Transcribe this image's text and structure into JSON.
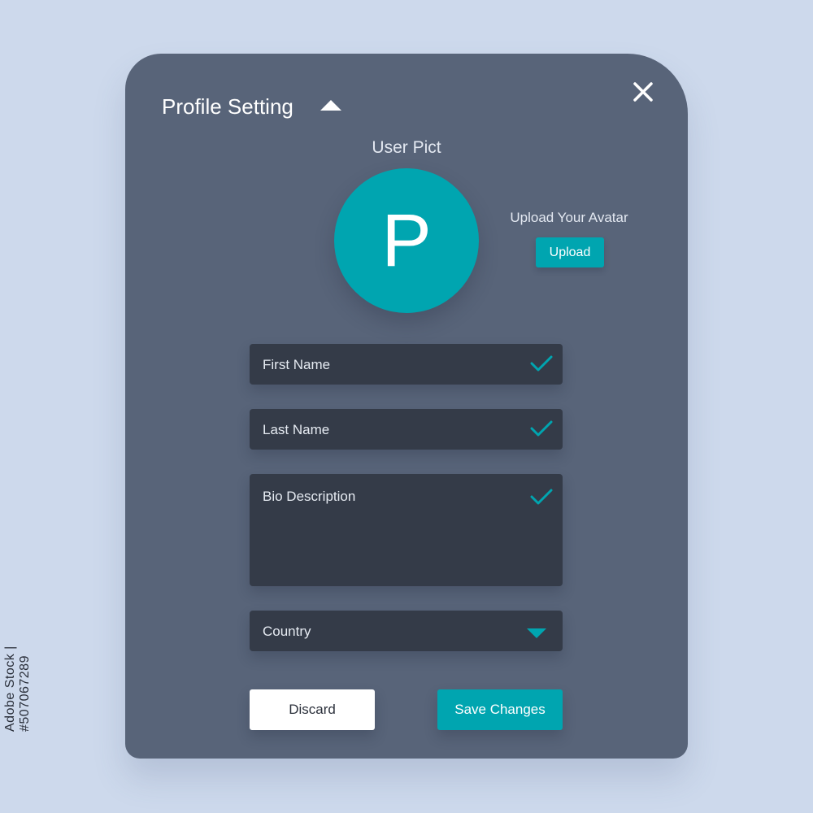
{
  "dialog": {
    "title": "Profile Setting",
    "icons": {
      "collapse": "triangle-up-icon",
      "close": "close-icon"
    }
  },
  "avatar": {
    "section_label": "User Pict",
    "initial": "P",
    "upload_label": "Upload Your Avatar",
    "upload_button": "Upload"
  },
  "form": {
    "first_name": {
      "label": "First Name",
      "status": "valid"
    },
    "last_name": {
      "label": "Last Name",
      "status": "valid"
    },
    "bio": {
      "label": "Bio Description",
      "status": "valid"
    },
    "country": {
      "label": "Country"
    }
  },
  "actions": {
    "discard": "Discard",
    "save": "Save Changes"
  },
  "watermark": {
    "id_text": "Adobe Stock | #507067289"
  },
  "colors": {
    "background": "#cdd9ec",
    "panel": "#586479",
    "field": "#343b48",
    "accent": "#00a5b0",
    "text_light": "#e6ebf2",
    "button_light": "#ffffff"
  }
}
